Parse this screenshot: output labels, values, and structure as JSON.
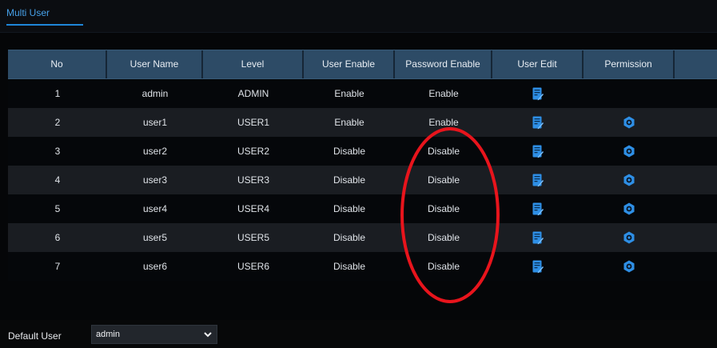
{
  "tabs": [
    {
      "label": "Multi User",
      "active": true
    }
  ],
  "table": {
    "headers": [
      "No",
      "User Name",
      "Level",
      "User Enable",
      "Password Enable",
      "User Edit",
      "Permission",
      ""
    ],
    "rows": [
      {
        "no": "1",
        "name": "admin",
        "level": "ADMIN",
        "user_enable": "Enable",
        "password_enable": "Enable",
        "edit": true,
        "permission": false
      },
      {
        "no": "2",
        "name": "user1",
        "level": "USER1",
        "user_enable": "Enable",
        "password_enable": "Enable",
        "edit": true,
        "permission": true
      },
      {
        "no": "3",
        "name": "user2",
        "level": "USER2",
        "user_enable": "Disable",
        "password_enable": "Disable",
        "edit": true,
        "permission": true
      },
      {
        "no": "4",
        "name": "user3",
        "level": "USER3",
        "user_enable": "Disable",
        "password_enable": "Disable",
        "edit": true,
        "permission": true
      },
      {
        "no": "5",
        "name": "user4",
        "level": "USER4",
        "user_enable": "Disable",
        "password_enable": "Disable",
        "edit": true,
        "permission": true
      },
      {
        "no": "6",
        "name": "user5",
        "level": "USER5",
        "user_enable": "Disable",
        "password_enable": "Disable",
        "edit": true,
        "permission": true
      },
      {
        "no": "7",
        "name": "user6",
        "level": "USER6",
        "user_enable": "Disable",
        "password_enable": "Disable",
        "edit": true,
        "permission": true
      }
    ]
  },
  "footer": {
    "default_user_label": "Default User",
    "default_user_value": "admin"
  },
  "icons": {
    "edit": "edit-icon",
    "permission": "gear-icon",
    "dropdown": "chevron-down-icon"
  },
  "colors": {
    "accent": "#1f86d8",
    "header_bg": "#2d4b66",
    "annotation": "#e8141c"
  }
}
